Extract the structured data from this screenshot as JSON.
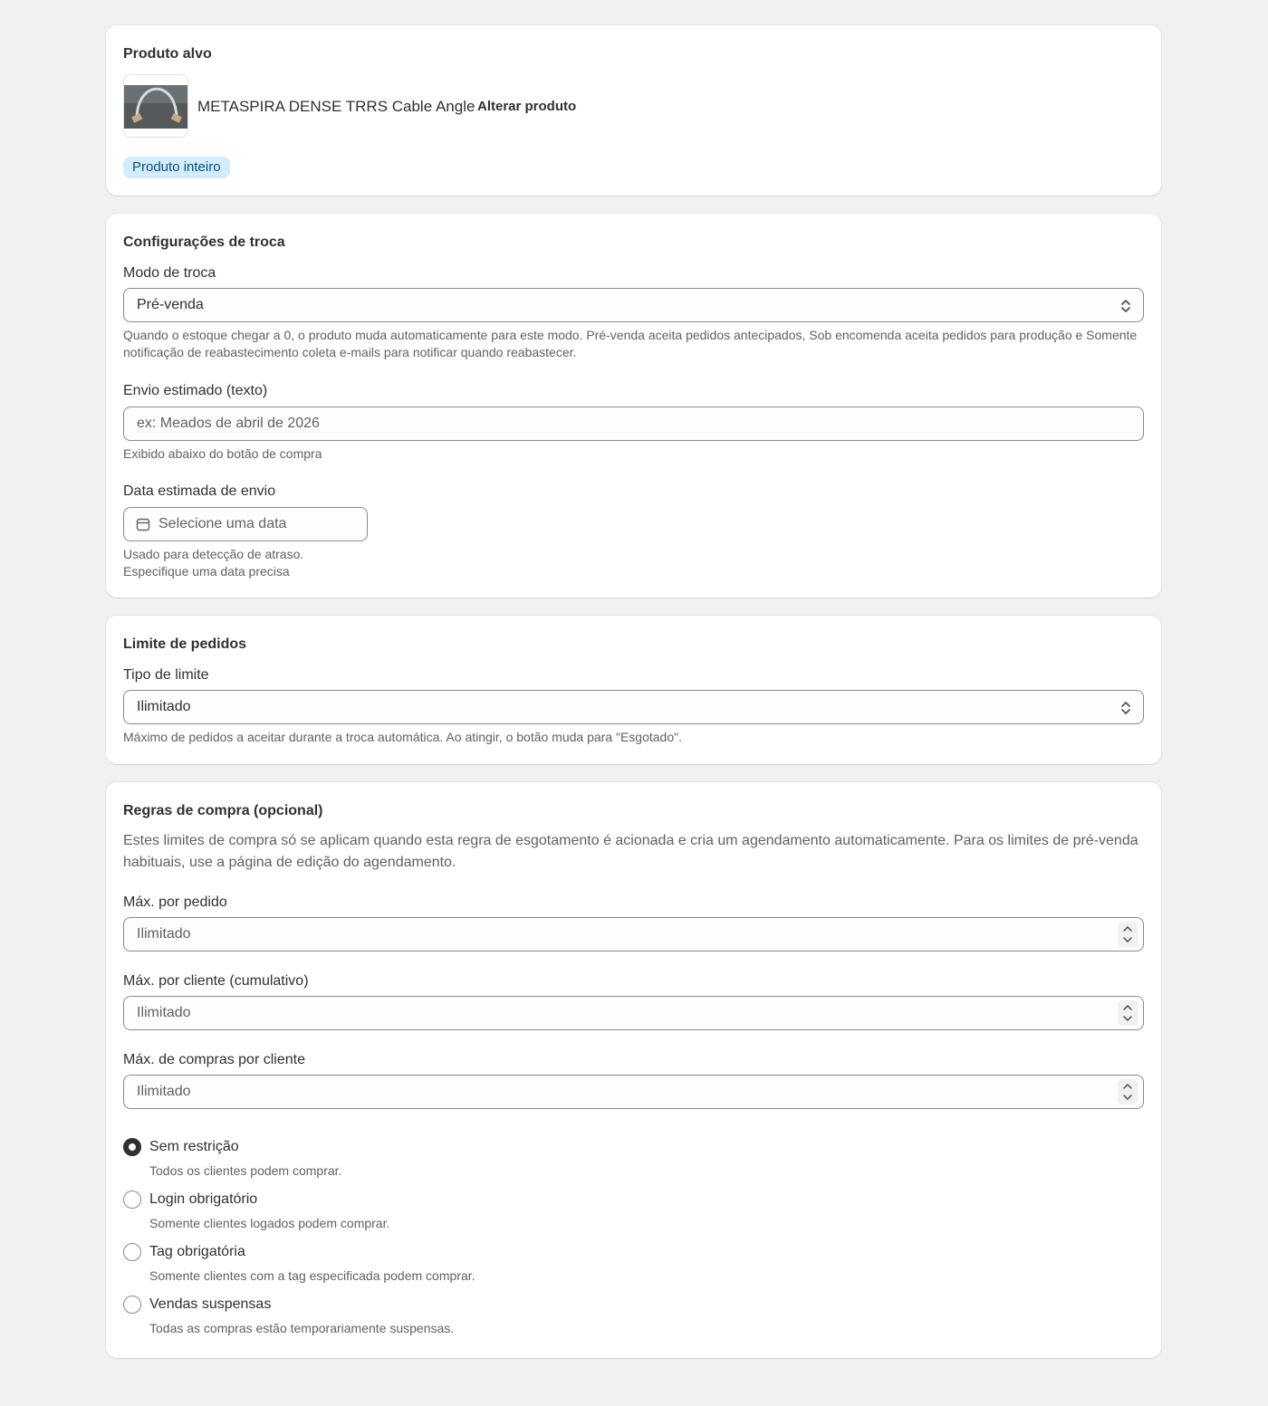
{
  "target_product": {
    "title": "Produto alvo",
    "product_name": "METASPIRA DENSE TRRS Cable Angle",
    "change_button": "Alterar produto",
    "scope_badge": "Produto inteiro"
  },
  "exchange_settings": {
    "title": "Configurações de troca",
    "mode_label": "Modo de troca",
    "mode_value": "Pré-venda",
    "mode_help": "Quando o estoque chegar a 0, o produto muda automaticamente para este modo. Pré-venda aceita pedidos antecipados, Sob encomenda aceita pedidos para produção e Somente notificação de reabastecimento coleta e-mails para notificar quando reabastecer.",
    "shipping_text_label": "Envio estimado (texto)",
    "shipping_text_placeholder": "ex: Meados de abril de 2026",
    "shipping_text_help": "Exibido abaixo do botão de compra",
    "shipping_date_label": "Data estimada de envio",
    "shipping_date_placeholder": "Selecione uma data",
    "shipping_date_help_1": "Usado para detecção de atraso.",
    "shipping_date_help_2": "Especifique uma data precisa"
  },
  "order_limit": {
    "title": "Limite de pedidos",
    "type_label": "Tipo de limite",
    "type_value": "Ilimitado",
    "help": "Máximo de pedidos a aceitar durante a troca automática. Ao atingir, o botão muda para \"Esgotado\"."
  },
  "purchase_rules": {
    "title": "Regras de compra (opcional)",
    "description": "Estes limites de compra só se aplicam quando esta regra de esgotamento é acionada e cria um agendamento automaticamente. Para os limites de pré-venda habituais, use a página de edição do agendamento.",
    "max_per_order_label": "Máx. por pedido",
    "max_per_order_placeholder": "Ilimitado",
    "max_per_customer_label": "Máx. por cliente (cumulativo)",
    "max_per_customer_placeholder": "Ilimitado",
    "max_purchases_label": "Máx. de compras por cliente",
    "max_purchases_placeholder": "Ilimitado",
    "options": [
      {
        "label": "Sem restrição",
        "description": "Todos os clientes podem comprar.",
        "selected": true
      },
      {
        "label": "Login obrigatório",
        "description": "Somente clientes logados podem comprar.",
        "selected": false
      },
      {
        "label": "Tag obrigatória",
        "description": "Somente clientes com a tag especificada podem comprar.",
        "selected": false
      },
      {
        "label": "Vendas suspensas",
        "description": "Todas as compras estão temporariamente suspensas.",
        "selected": false
      }
    ]
  },
  "colors": {
    "background": "#f1f1f1",
    "card": "#ffffff",
    "text": "#303030",
    "subdued_text": "#616161",
    "badge_bg": "#d5ebff",
    "border": "#8a8a8a"
  }
}
